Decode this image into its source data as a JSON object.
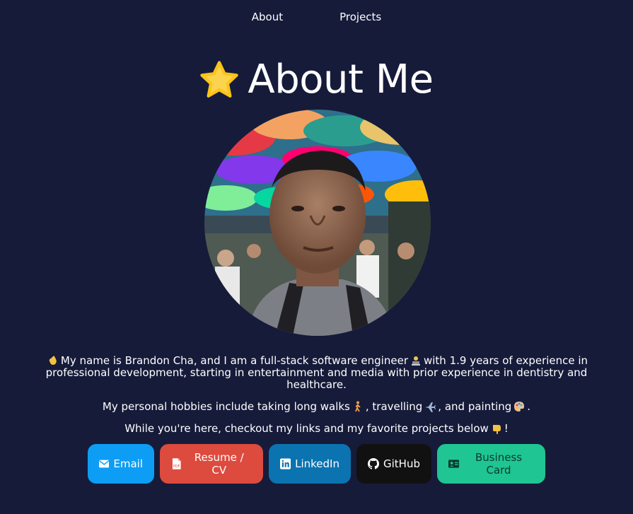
{
  "nav": {
    "about": "About",
    "projects": "Projects"
  },
  "heading": {
    "title": "About Me",
    "icon": "star-icon"
  },
  "bio": {
    "line1_a": "My name is Brandon Cha, and I am a full-stack software engineer",
    "line1_b": "with 1.9 years of experience in professional development, starting in entertainment and media with prior experience in dentistry and healthcare.",
    "line2_a": "My personal hobbies include taking long walks",
    "line2_b": ", travelling",
    "line2_c": ", and painting",
    "line2_d": ".",
    "line3_a": "While you're here, checkout my links and my favorite projects below",
    "line3_b": "!"
  },
  "buttons": {
    "email": {
      "label": "Email",
      "color": "#0d9df5"
    },
    "resume": {
      "label": "Resume / CV",
      "color": "#dd4b3e"
    },
    "linkedin": {
      "label": "LinkedIn",
      "color": "#0b73b0"
    },
    "github": {
      "label": "GitHub",
      "color": "#111111"
    },
    "business_card": {
      "label": "Business Card",
      "color": "#1fc592",
      "text_color": "#0b3b2e"
    }
  },
  "colors": {
    "background": "#161b3a",
    "text": "#ffffff"
  }
}
